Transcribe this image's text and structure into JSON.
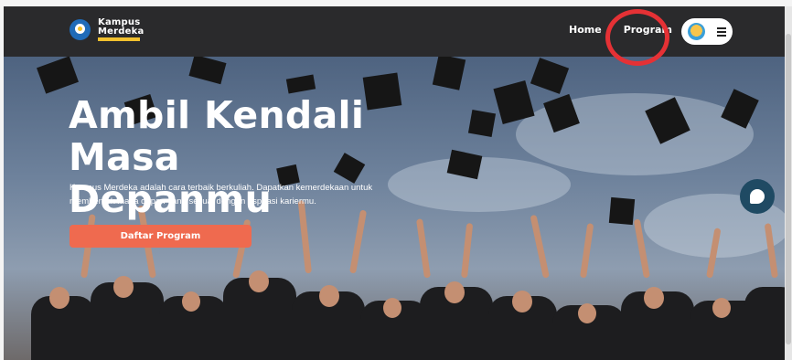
{
  "nav": {
    "logo_line1": "Kampus",
    "logo_line2": "Merdeka",
    "links": [
      {
        "label": "Home"
      },
      {
        "label": "Program"
      }
    ]
  },
  "hero": {
    "title": "Ambil Kendali Masa Depanmu",
    "description": "Kampus Merdeka adalah cara terbaik berkuliah. Dapatkan kemerdekaan untuk membentuk masa depan yang sesuai dengan aspirasi kariermu.",
    "cta_label": "Daftar Program"
  },
  "icons": {
    "logo": "kampus-merdeka-emblem",
    "chat": "chat-bubble-icon",
    "menu": "hamburger-icon"
  },
  "colors": {
    "navbar": "#2a2a2c",
    "cta": "#ef6a4f",
    "highlight": "#e53135",
    "chat": "#1f4a63"
  }
}
